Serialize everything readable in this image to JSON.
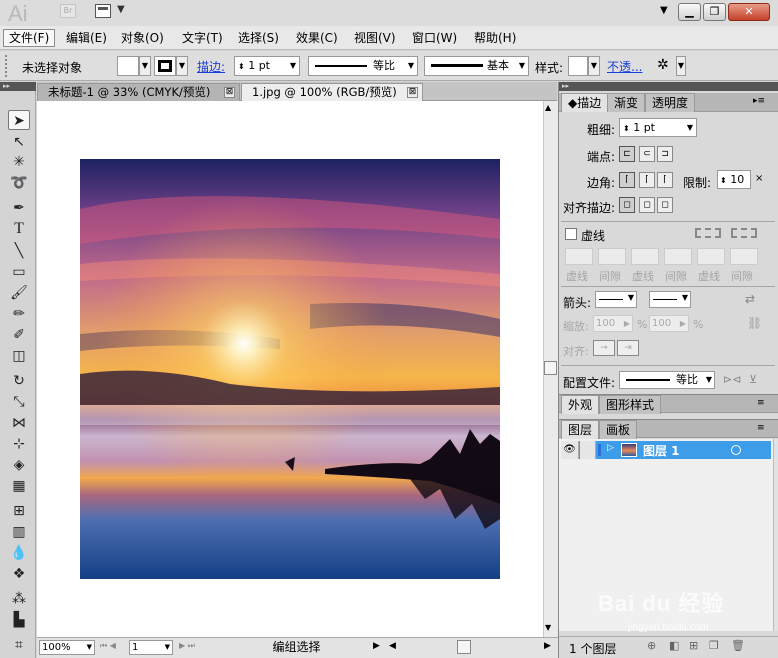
{
  "app": {
    "logo": "Ai",
    "bridge_badge": "Br"
  },
  "menu": [
    {
      "label": "文件(F)"
    },
    {
      "label": "编辑(E)"
    },
    {
      "label": "对象(O)"
    },
    {
      "label": "文字(T)"
    },
    {
      "label": "选择(S)"
    },
    {
      "label": "效果(C)"
    },
    {
      "label": "视图(V)"
    },
    {
      "label": "窗口(W)"
    },
    {
      "label": "帮助(H)"
    }
  ],
  "control": {
    "selection_label": "未选择对象",
    "stroke_link": "描边:",
    "stroke_weight": "1 pt",
    "profile": "等比",
    "brush": "基本",
    "style_label": "样式:",
    "opacity_link": "不透..."
  },
  "tabs": [
    {
      "label": "未标题-1 @ 33% (CMYK/预览)",
      "close": "⊠"
    },
    {
      "label": "1.jpg @ 100% (RGB/预览)",
      "close": "⊠"
    }
  ],
  "status": {
    "zoom": "100%",
    "page": "1",
    "tool": "编组选择"
  },
  "panel_stroke": {
    "tabs": [
      "描边",
      "渐变",
      "透明度"
    ],
    "weight_label": "粗细:",
    "weight": "1 pt",
    "cap_label": "端点:",
    "corner_label": "边角:",
    "limit_label": "限制:",
    "limit": "10",
    "align_label": "对齐描边:",
    "dashed_label": "虚线",
    "dash_labels": [
      "虚线",
      "间隙",
      "虚线",
      "间隙",
      "虚线",
      "间隙"
    ],
    "arrow_label": "箭头:",
    "scale_label": "缩放:",
    "scale1": "100",
    "scale2": "100",
    "pct": "%",
    "align2_label": "对齐:",
    "profile_label": "配置文件:",
    "profile": "等比"
  },
  "panel_appearance": {
    "tabs": [
      "外观",
      "图形样式"
    ]
  },
  "panel_layers": {
    "tabs": [
      "图层",
      "画板"
    ],
    "layer_name": "图层 1",
    "layer_color": "#3e9de8",
    "count": "1 个图层"
  },
  "watermark": {
    "brand": "Bai du 经验",
    "url": "jingyan.baidu.com"
  }
}
